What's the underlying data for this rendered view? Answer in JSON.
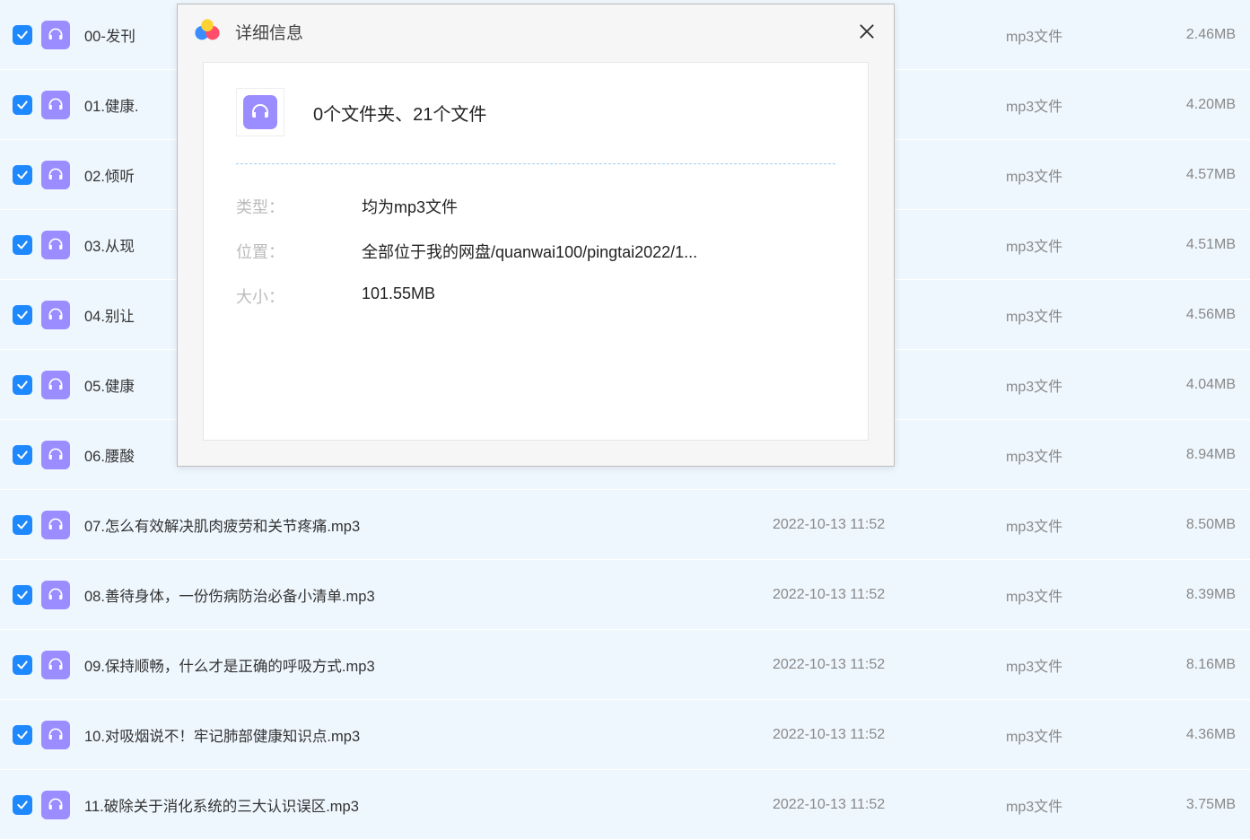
{
  "files": [
    {
      "name": "00-发刊",
      "date": "",
      "type": "mp3文件",
      "size": "2.46MB"
    },
    {
      "name": "01.健康.",
      "date": "",
      "type": "mp3文件",
      "size": "4.20MB"
    },
    {
      "name": "02.倾听",
      "date": "",
      "type": "mp3文件",
      "size": "4.57MB"
    },
    {
      "name": "03.从现",
      "date": "",
      "type": "mp3文件",
      "size": "4.51MB"
    },
    {
      "name": "04.别让",
      "date": "",
      "type": "mp3文件",
      "size": "4.56MB"
    },
    {
      "name": "05.健康",
      "date": "",
      "type": "mp3文件",
      "size": "4.04MB"
    },
    {
      "name": "06.腰酸",
      "date": "",
      "type": "mp3文件",
      "size": "8.94MB"
    },
    {
      "name": "07.怎么有效解决肌肉疲劳和关节疼痛.mp3",
      "date": "2022-10-13 11:52",
      "type": "mp3文件",
      "size": "8.50MB"
    },
    {
      "name": "08.善待身体，一份伤病防治必备小清单.mp3",
      "date": "2022-10-13 11:52",
      "type": "mp3文件",
      "size": "8.39MB"
    },
    {
      "name": "09.保持顺畅，什么才是正确的呼吸方式.mp3",
      "date": "2022-10-13 11:52",
      "type": "mp3文件",
      "size": "8.16MB"
    },
    {
      "name": "10.对吸烟说不！牢记肺部健康知识点.mp3",
      "date": "2022-10-13 11:52",
      "type": "mp3文件",
      "size": "4.36MB"
    },
    {
      "name": "11.破除关于消化系统的三大认识误区.mp3",
      "date": "2022-10-13 11:52",
      "type": "mp3文件",
      "size": "3.75MB"
    }
  ],
  "dialog": {
    "title": "详细信息",
    "summary": "0个文件夹、21个文件",
    "labels": {
      "type": "类型：",
      "location": "位置：",
      "size": "大小："
    },
    "values": {
      "type": "均为mp3文件",
      "location": "全部位于我的网盘/quanwai100/pingtai2022/1...",
      "size": "101.55MB"
    }
  }
}
